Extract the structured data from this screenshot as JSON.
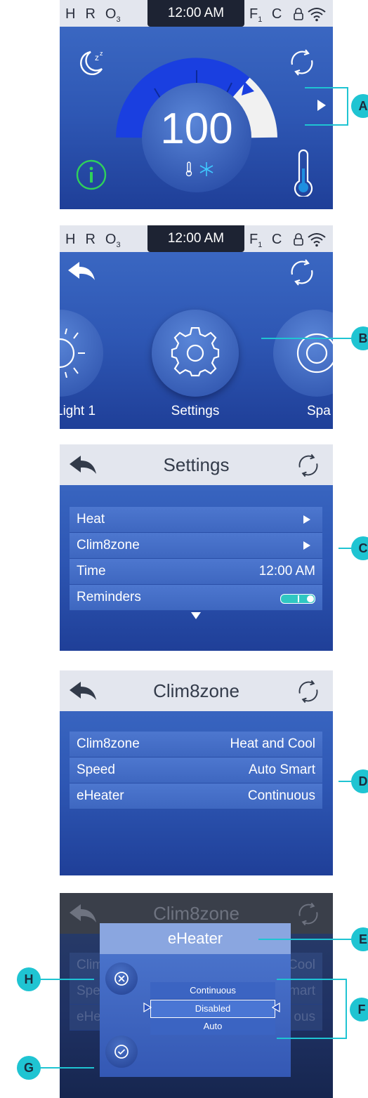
{
  "status": {
    "h": "H",
    "r": "R",
    "o": "O",
    "o_sub": "3",
    "time": "12:00 AM",
    "f": "F",
    "f_sub": "1",
    "c": "C"
  },
  "screen1": {
    "temperature": "100"
  },
  "screen2": {
    "items": [
      {
        "label": "Light 1"
      },
      {
        "label": "Settings"
      },
      {
        "label": "Spa"
      }
    ]
  },
  "screen3": {
    "title": "Settings",
    "rows": [
      {
        "label": "Heat",
        "value": ""
      },
      {
        "label": "Clim8zone",
        "value": ""
      },
      {
        "label": "Time",
        "value": "12:00 AM"
      },
      {
        "label": "Reminders",
        "value": ""
      }
    ]
  },
  "screen4": {
    "title": "Clim8zone",
    "rows": [
      {
        "label": "Clim8zone",
        "value": "Heat and Cool"
      },
      {
        "label": "Speed",
        "value": "Auto Smart"
      },
      {
        "label": "eHeater",
        "value": "Continuous"
      }
    ]
  },
  "screen5": {
    "title": "Clim8zone",
    "dialog_title": "eHeater",
    "bg_rows": [
      {
        "label": "Clim",
        "value": "Cool"
      },
      {
        "label": "Spe",
        "value": "mart"
      },
      {
        "label": "eHe",
        "value": "ous"
      }
    ],
    "options": [
      "Continuous",
      "Disabled",
      "Auto"
    ],
    "selected_index": 1
  },
  "callouts": [
    "A",
    "B",
    "C",
    "D",
    "E",
    "F",
    "G",
    "H"
  ],
  "colors": {
    "accent": "#1fc4d2",
    "screen_blue": "#2e57b4",
    "statusbar": "#e3e6ee",
    "bright_blue": "#1a3fe0",
    "info_green": "#2fd15a"
  }
}
